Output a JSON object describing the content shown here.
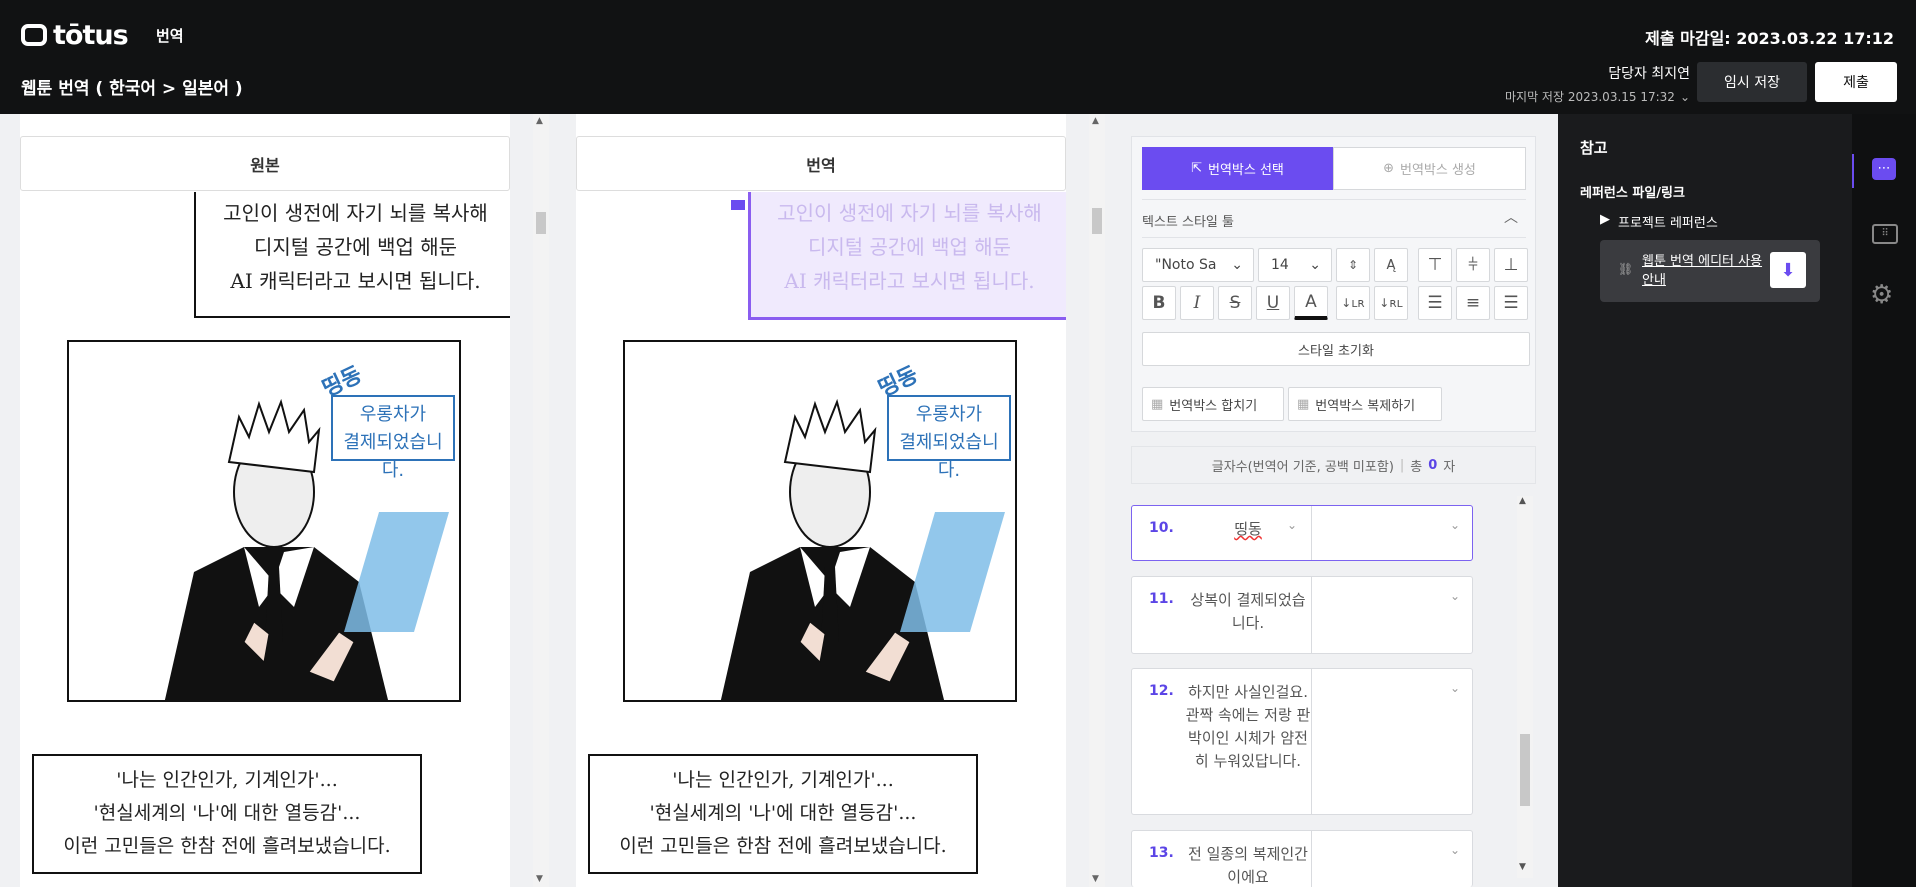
{
  "app": {
    "brand": "tōtus",
    "nav_label": "번역",
    "deadline": "제출 마감일: 2023.03.22 17:12",
    "title": "웹툰 번역 ( 한국어 > 일본어 )",
    "assignee": "담당자 최지연",
    "last_saved": "마지막 저장 2023.03.15 17:32",
    "temp_save": "임시 저장",
    "submit": "제출"
  },
  "columns": {
    "source_header": "원본",
    "target_header": "번역"
  },
  "comic": {
    "top_lines": [
      "고인이 생전에 자기 뇌를 복사해",
      "디지털 공간에 백업 해둔",
      "AI 캐릭터라고 보시면 됩니다."
    ],
    "sfx": "띵동",
    "bubble_lines": [
      "우롱차가",
      "결제되었습니다."
    ],
    "bottom_lines": [
      "'나는 인간인가, 기계인가'...",
      "'현실세계의 '나'에 대한 열등감'...",
      "이런 고민들은 한참 전에 흘려보냈습니다."
    ]
  },
  "tools": {
    "mode_select": "번역박스 선택",
    "mode_create": "번역박스 생성",
    "section_title": "텍스트 스타일 툴",
    "font": "\"Noto Sa",
    "size": "14",
    "reset": "스타일 초기화",
    "merge": "번역박스 합치기",
    "duplicate": "번역박스 복제하기",
    "style_buttons": [
      "B",
      "I",
      "S",
      "U",
      "A"
    ]
  },
  "counter": {
    "label": "글자수(번역어 기준, 공백 미포함)",
    "sep": "|",
    "total_prefix": "총",
    "total": "0",
    "unit": "자"
  },
  "rows": [
    {
      "num": "10.",
      "text": "띵동"
    },
    {
      "num": "11.",
      "text": "상복이 결제되었습니다."
    },
    {
      "num": "12.",
      "text": "하지만 사실인걸요. 관짝 속에는 저랑 판박이인 시체가 얌전히 누워있답니다."
    },
    {
      "num": "13.",
      "text": "전 일종의 복제인간이에요"
    }
  ],
  "reference": {
    "title": "참고",
    "files_label": "레퍼런스 파일/링크",
    "project_ref": "프로젝트 레퍼런스",
    "doc_link": "웹툰 번역 에디터 사용 안내"
  },
  "colors": {
    "accent": "#6b4cf0",
    "topbar": "#111213",
    "panel": "#1a1b1d"
  }
}
